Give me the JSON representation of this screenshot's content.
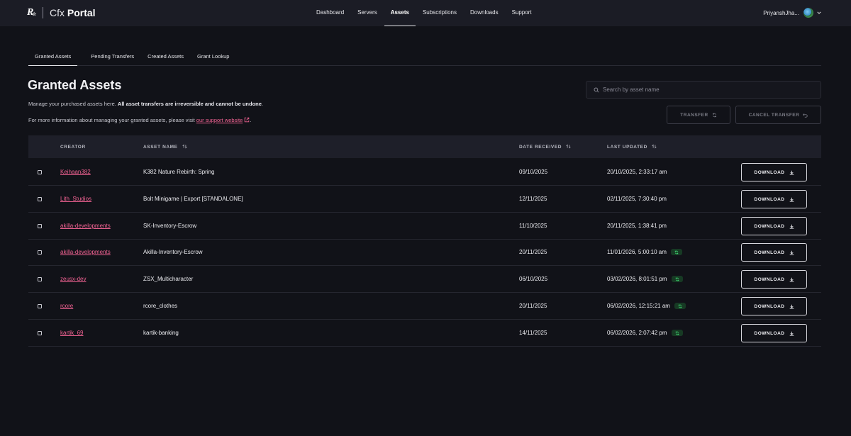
{
  "brand": {
    "mark": "R",
    "name_light": "Cfx",
    "name_bold": "Portal"
  },
  "nav": {
    "items": [
      {
        "label": "Dashboard",
        "active": false
      },
      {
        "label": "Servers",
        "active": false
      },
      {
        "label": "Assets",
        "active": true
      },
      {
        "label": "Subscriptions",
        "active": false
      },
      {
        "label": "Downloads",
        "active": false
      },
      {
        "label": "Support",
        "active": false
      }
    ]
  },
  "user": {
    "name": "PriyanshJha..."
  },
  "tabs": [
    {
      "label": "Granted Assets",
      "active": true
    },
    {
      "label": "Pending Transfers",
      "active": false
    },
    {
      "label": "Created Assets",
      "active": false
    },
    {
      "label": "Grant Lookup",
      "active": false
    }
  ],
  "page": {
    "title": "Granted Assets",
    "desc_plain": "Manage your purchased assets here. ",
    "desc_bold": "All asset transfers are irreversible and cannot be undone",
    "desc_end": ".",
    "info_prefix": "For more information about managing your granted assets, please visit ",
    "info_link": "our support website",
    "info_suffix": "."
  },
  "search": {
    "placeholder": "Search by asset name",
    "value": ""
  },
  "actions": {
    "transfer": "TRANSFER",
    "cancel_transfer": "CANCEL TRANSFER"
  },
  "table": {
    "headers": {
      "creator": "CREATOR",
      "asset_name": "ASSET NAME",
      "date_received": "DATE RECEIVED",
      "last_updated": "LAST UPDATED"
    },
    "download_label": "DOWNLOAD",
    "rows": [
      {
        "creator": "Keihaan382",
        "asset": "K382 Nature Rebirth: Spring",
        "date_received": "09/10/2025",
        "last_updated": "20/10/2025, 2:33:17 am",
        "synced": false
      },
      {
        "creator": "Lith_Studios",
        "asset": "Bolt Minigame | Export [STANDALONE]",
        "date_received": "12/11/2025",
        "last_updated": "02/11/2025, 7:30:40 pm",
        "synced": false
      },
      {
        "creator": "akilla-developments",
        "asset": "SK-Inventory-Escrow",
        "date_received": "11/10/2025",
        "last_updated": "20/11/2025, 1:38:41 pm",
        "synced": false
      },
      {
        "creator": "akilla-developments",
        "asset": "Akilla-Inventory-Escrow",
        "date_received": "20/11/2025",
        "last_updated": "11/01/2026, 5:00:10 am",
        "synced": true
      },
      {
        "creator": "zeusx-dev",
        "asset": "ZSX_Multicharacter",
        "date_received": "06/10/2025",
        "last_updated": "03/02/2026, 8:01:51 pm",
        "synced": true
      },
      {
        "creator": "rcore",
        "asset": "rcore_clothes",
        "date_received": "20/11/2025",
        "last_updated": "06/02/2026, 12:15:21 am",
        "synced": true
      },
      {
        "creator": "kartik_69",
        "asset": "kartik-banking",
        "date_received": "14/11/2025",
        "last_updated": "06/02/2026, 2:07:42 pm",
        "synced": true
      }
    ]
  },
  "colors": {
    "accent_link": "#f06292",
    "background": "#111218",
    "topbar": "#1b1c25",
    "sync_badge": "#173a24",
    "sync_icon": "#3ecf6e"
  }
}
